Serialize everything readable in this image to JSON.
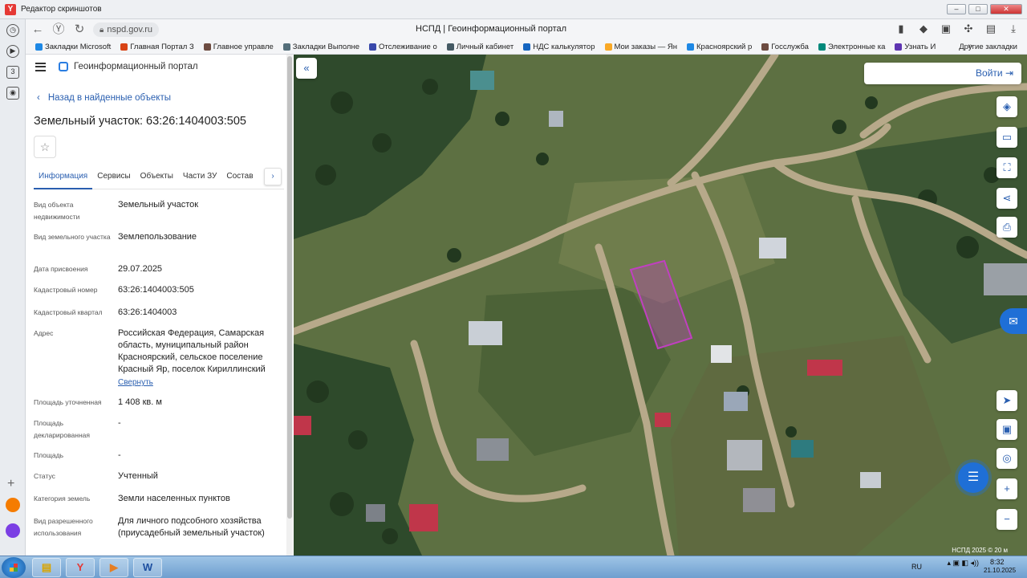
{
  "window": {
    "title": "Редактор скриншотов",
    "app_letter": "Y"
  },
  "browser": {
    "url": "nspd.gov.ru",
    "page_title": "НСПД | Геоинформационный портал",
    "sidebar_badge": "3"
  },
  "bookmarks": {
    "items": [
      "Закладки Microsoft",
      "Главная Портал З",
      "Главное управле",
      "Закладки Выполне",
      "Отслеживание о",
      "Личный кабинет",
      "НДС калькулятор",
      "Мои заказы — Ян",
      "Красноярский р",
      "Госслужба",
      "Электронные ка",
      "Узнать И"
    ],
    "more": "»",
    "other": "Другие закладки"
  },
  "panel": {
    "portal_name": "Геоинформационный портал",
    "back_link": "Назад в найденные объекты",
    "object_title": "Земельный участок: 63:26:1404003:505",
    "tabs": [
      "Информация",
      "Сервисы",
      "Объекты",
      "Части ЗУ",
      "Состав"
    ],
    "tab_scroll": "›",
    "attributes": [
      {
        "label": "Вид объекта недвижимости",
        "value": "Земельный участок"
      },
      {
        "label": "Вид земельного участка",
        "value": "Землепользование"
      },
      {
        "label": "Дата присвоения",
        "value": "29.07.2025"
      },
      {
        "label": "Кадастровый номер",
        "value": "63:26:1404003:505"
      },
      {
        "label": "Кадастровый квартал",
        "value": "63:26:1404003"
      },
      {
        "label": "Адрес",
        "value": "Российская Федерация, Самарская область, муниципальный район Красноярский, сельское поселение Красный Яр, поселок Кириллинский"
      },
      {
        "label": "Площадь уточненная",
        "value": "1 408 кв. м"
      },
      {
        "label": "Площадь декларированная",
        "value": "-"
      },
      {
        "label": "Площадь",
        "value": "-"
      },
      {
        "label": "Статус",
        "value": "Учтенный"
      },
      {
        "label": "Категория земель",
        "value": "Земли населенных пунктов"
      },
      {
        "label": "Вид разрешенного использования",
        "value": "Для личного подсобного хозяйства (приусадебный земельный участок)"
      }
    ],
    "collapse_link": "Свернуть"
  },
  "map": {
    "login_label": "Войти",
    "scale_text": "НСПД 2025 ©  20 м",
    "parcel_color": "#c040c0"
  },
  "taskbar": {
    "lang": "RU",
    "time": "8:32",
    "date": "21.10.2025"
  }
}
